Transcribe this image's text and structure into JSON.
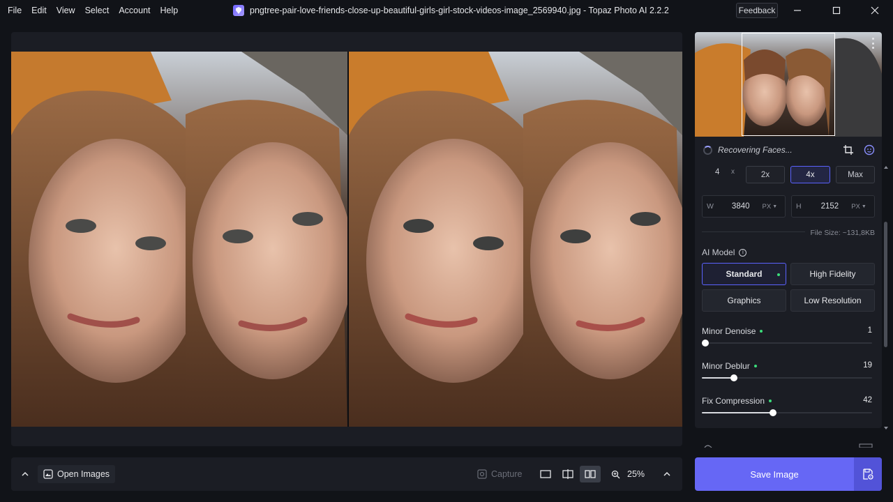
{
  "menu": [
    "File",
    "Edit",
    "View",
    "Select",
    "Account",
    "Help"
  ],
  "window": {
    "title": "pngtree-pair-love-friends-close-up-beautiful-girls-girl-stock-videos-image_2569940.jpg - Topaz Photo AI 2.2.2",
    "feedback_label": "Feedback"
  },
  "panel": {
    "status": "Recovering Faces...",
    "scale": {
      "value": "4",
      "x_label": "x",
      "options": [
        "2x",
        "4x",
        "Max"
      ],
      "selected": "4x"
    },
    "dimensions": {
      "w_label": "W",
      "width": "3840",
      "width_unit": "PX",
      "h_label": "H",
      "height": "2152",
      "height_unit": "PX"
    },
    "file_size": "File Size: ~131,8KB",
    "ai_model": {
      "label": "AI Model",
      "options": [
        "Standard",
        "High Fidelity",
        "Graphics",
        "Low Resolution"
      ],
      "selected": "Standard"
    },
    "sliders": [
      {
        "label": "Minor Denoise",
        "value": "1",
        "fraction": 0.02
      },
      {
        "label": "Minor Deblur",
        "value": "19",
        "fraction": 0.19
      },
      {
        "label": "Fix Compression",
        "value": "42",
        "fraction": 0.42
      }
    ]
  },
  "bottom": {
    "open_images": "Open Images",
    "capture": "Capture",
    "zoom": "25%"
  },
  "save": {
    "label": "Save Image"
  },
  "colors": {
    "accent": "#6667f5",
    "active_border": "#5b62ff",
    "status_dot": "#3bdc7a"
  },
  "icons": [
    "app-logo-icon",
    "minimize-icon",
    "maximize-icon",
    "close-icon",
    "kebab-menu-icon",
    "spinner-icon",
    "crop-icon",
    "face-icon",
    "info-icon",
    "chevron-up-icon",
    "open-images-icon",
    "capture-icon",
    "single-view-icon",
    "split-view-icon",
    "side-by-side-icon",
    "zoom-icon",
    "export-settings-icon"
  ]
}
